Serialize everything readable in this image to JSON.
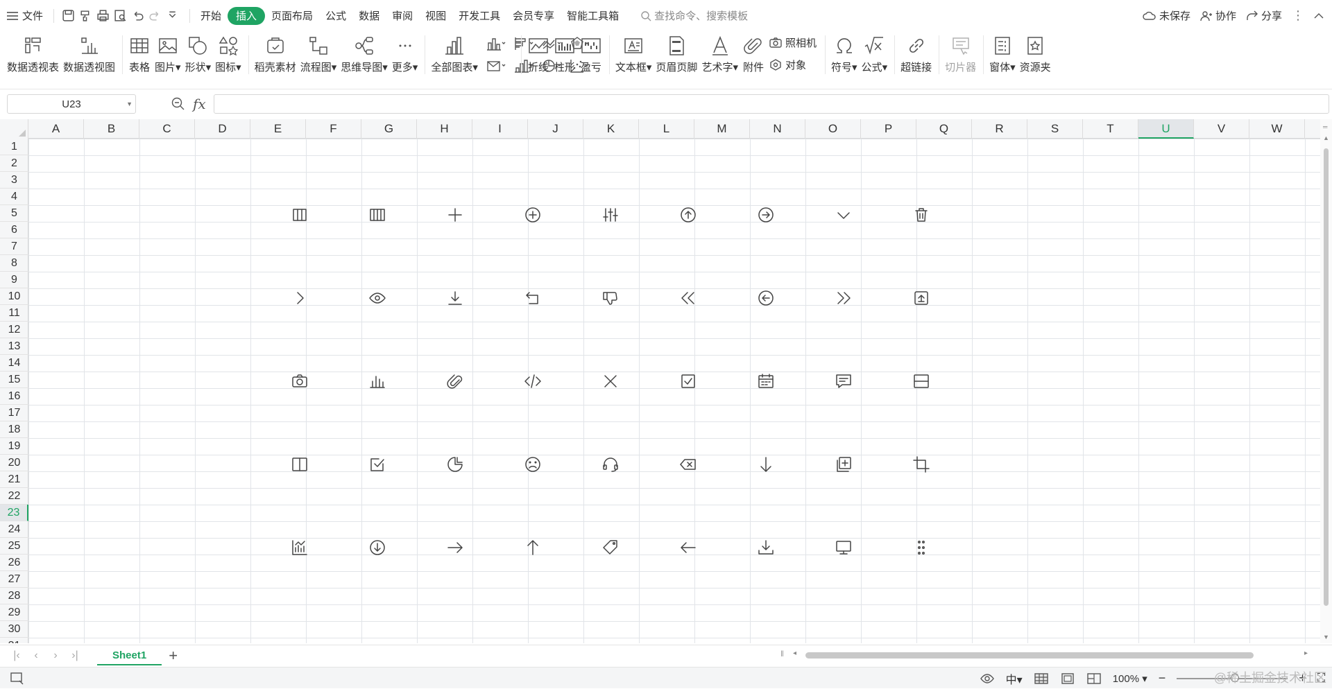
{
  "menubar": {
    "file": "文件",
    "tabs": [
      "开始",
      "插入",
      "页面布局",
      "公式",
      "数据",
      "审阅",
      "视图",
      "开发工具",
      "会员专享",
      "智能工具箱"
    ],
    "active_tab": "插入",
    "search_placeholder": "查找命令、搜索模板",
    "unsaved": "未保存",
    "collab": "协作",
    "share": "分享"
  },
  "ribbon": {
    "pivot_table": "数据透视表",
    "pivot_chart": "数据透视图",
    "table": "表格",
    "picture": "图片",
    "shape": "形状",
    "icon": "图标",
    "material": "稻壳素材",
    "flowchart": "流程图",
    "mindmap": "思维导图",
    "more": "更多",
    "all_charts": "全部图表",
    "line": "折线",
    "column": "柱形",
    "winloss": "盈亏",
    "textbox": "文本框",
    "header_footer": "页眉页脚",
    "wordart": "艺术字",
    "attachment": "附件",
    "camera": "照相机",
    "object": "对象",
    "symbol": "符号",
    "formula": "公式",
    "hyperlink": "超链接",
    "slicer": "切片器",
    "form": "窗体",
    "resources": "资源夹"
  },
  "formula_bar": {
    "cell_ref": "U23",
    "fx": "fx",
    "value": ""
  },
  "grid": {
    "columns": [
      "A",
      "B",
      "C",
      "D",
      "E",
      "F",
      "G",
      "H",
      "I",
      "J",
      "K",
      "L",
      "M",
      "N",
      "O",
      "P",
      "Q",
      "R",
      "S",
      "T",
      "U",
      "V",
      "W"
    ],
    "rows": [
      "1",
      "2",
      "3",
      "4",
      "5",
      "6",
      "7",
      "8",
      "9",
      "10",
      "11",
      "12",
      "13",
      "14",
      "15",
      "16",
      "17",
      "18",
      "19",
      "20",
      "21",
      "22",
      "23",
      "24",
      "25",
      "26",
      "27",
      "28",
      "29",
      "30",
      "31"
    ],
    "selected_column": "U",
    "selected_row": "23",
    "icon_rows": [
      {
        "row": "5",
        "icons": [
          "columns-3-icon",
          "columns-4-icon",
          "plus-icon",
          "plus-circle-icon",
          "sliders-icon",
          "arrow-up-circle-icon",
          "arrow-right-circle-icon",
          "chevron-down-icon",
          "trash-icon"
        ]
      },
      {
        "row": "10",
        "icons": [
          "chevron-right-icon",
          "eye-icon",
          "download-icon",
          "undo-return-icon",
          "thumbs-down-icon",
          "chevrons-left-icon",
          "arrow-left-circle-icon",
          "chevrons-right-icon",
          "upload-box-icon"
        ]
      },
      {
        "row": "15",
        "icons": [
          "camera-icon",
          "bar-chart-icon",
          "paperclip-icon",
          "code-icon",
          "close-x-icon",
          "checkbox-icon",
          "calendar-icon",
          "message-icon",
          "split-horizontal-icon"
        ]
      },
      {
        "row": "20",
        "icons": [
          "split-vertical-icon",
          "check-square-icon",
          "pie-chart-icon",
          "sad-face-icon",
          "headset-icon",
          "backspace-icon",
          "arrow-down-icon",
          "copy-add-icon",
          "crop-icon"
        ]
      },
      {
        "row": "25",
        "icons": [
          "chart-analytics-icon",
          "download-circle-icon",
          "arrow-right-icon",
          "arrow-up-icon",
          "tag-icon",
          "arrow-left-icon",
          "download-tray-icon",
          "monitor-icon",
          "drag-handle-icon"
        ]
      }
    ]
  },
  "sheets": {
    "tabs": [
      "Sheet1"
    ],
    "active": "Sheet1"
  },
  "status": {
    "zoom": "100%",
    "watermark": "@稀土掘金技术社区"
  },
  "colors": {
    "accent": "#1fa463",
    "grid_line": "#e1e4e8",
    "header_bg": "#f5f6f7"
  }
}
